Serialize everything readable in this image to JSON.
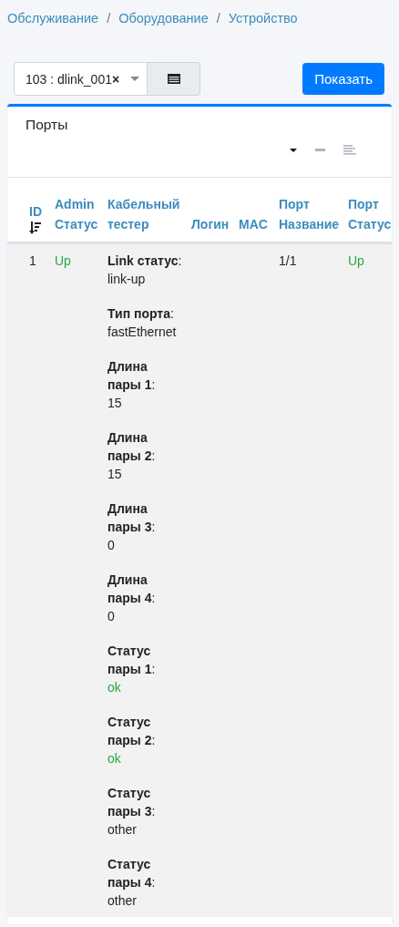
{
  "breadcrumb": [
    "Обслуживание",
    "Оборудование",
    "Устройство"
  ],
  "breadcrumb_separator": "/",
  "toolbar": {
    "device_select": {
      "value": "103 : dlink_001",
      "clear": "×"
    },
    "show_button": "Показать"
  },
  "card": {
    "title": "Порты",
    "table": {
      "columns": [
        {
          "label": "ID",
          "sorted": true
        },
        {
          "label": "Admin Статус",
          "sorted": false
        },
        {
          "label": "Кабельный тестер",
          "sorted": false
        },
        {
          "label": "Логин",
          "sorted": false
        },
        {
          "label": "MAC",
          "sorted": false
        },
        {
          "label": "Порт Название",
          "sorted": false
        },
        {
          "label": "Порт Статус",
          "sorted": false
        }
      ],
      "rows": [
        {
          "id": "1",
          "admin_status": {
            "text": "Up",
            "success": true
          },
          "cable_tester": [
            {
              "label": "**Link статус**:",
              "value": "link-up",
              "success": false
            },
            {
              "label": "**Тип порта**:",
              "value": "fastEthernet",
              "success": false
            },
            {
              "label": "**Длина пары 1**:",
              "value": "15",
              "success": false
            },
            {
              "label": "**Длина пары 2**:",
              "value": "15",
              "success": false
            },
            {
              "label": "**Длина пары 3**:",
              "value": "0",
              "success": false
            },
            {
              "label": "**Длина пары 4**:",
              "value": "0",
              "success": false
            },
            {
              "label": "**Статус пары 1**:",
              "value": "ok",
              "success": true
            },
            {
              "label": "**Статус пары 2**:",
              "value": "ok",
              "success": true
            },
            {
              "label": "**Статус пары 3**:",
              "value": "other",
              "success": false
            },
            {
              "label": "**Статус пары 4**:",
              "value": "other",
              "success": false
            }
          ],
          "port_name": "1/1",
          "port_status": {
            "text": "Up",
            "success": true
          }
        }
      ]
    }
  }
}
